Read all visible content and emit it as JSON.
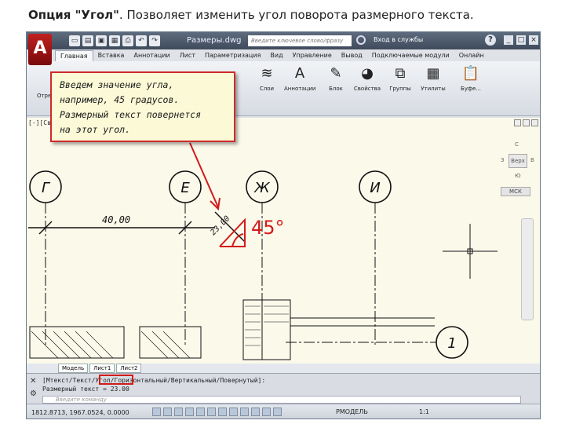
{
  "heading": {
    "bold": "Опция \"Угол\"",
    "text": ". Позволяет изменить угол поворота размерного текста."
  },
  "app": {
    "document_title": "Размеры.dwg",
    "search_placeholder": "Введите ключевое слово/фразу",
    "login_label": "Вход в службы",
    "help_label": "?",
    "window_buttons": [
      "_",
      "□",
      "×"
    ],
    "logo_letter": "A",
    "quick_access_icons": [
      "new-icon",
      "open-icon",
      "save-icon",
      "save-as-icon",
      "print-icon",
      "undo-icon",
      "redo-icon"
    ],
    "quick_access_glyphs": [
      "▭",
      "▤",
      "▣",
      "▦",
      "⎙",
      "↶",
      "↷"
    ]
  },
  "ribbon": {
    "tabs": [
      "Главная",
      "Вставка",
      "Аннотации",
      "Лист",
      "Параметризация",
      "Вид",
      "Управление",
      "Вывод",
      "Подключаемые модули",
      "Онлайн"
    ],
    "active_tab": 0,
    "tools": [
      {
        "label": "Отрез",
        "icon": "line-icon",
        "glyph": "╱"
      },
      {
        "label": "Слои",
        "icon": "layers-icon",
        "glyph": "≋"
      },
      {
        "label": "Аннотации",
        "icon": "text-icon",
        "glyph": "A"
      },
      {
        "label": "Блок",
        "icon": "block-icon",
        "glyph": "✎"
      },
      {
        "label": "Свойства",
        "icon": "properties-icon",
        "glyph": "◕"
      },
      {
        "label": "Группы",
        "icon": "groups-icon",
        "glyph": "⧉"
      },
      {
        "label": "Утилиты",
        "icon": "utilities-icon",
        "glyph": "▦"
      },
      {
        "label": "Буфе...",
        "icon": "clipboard-icon",
        "glyph": "📋"
      }
    ]
  },
  "callout": {
    "lines": [
      "Введем значение угла,",
      "например, 45 градусов.",
      "Размерный текст повернется",
      "на этот угол."
    ]
  },
  "viewport": {
    "label": "[-][Сверху][2D-каркас]",
    "axis_labels": [
      "Г",
      "Е",
      "Ж",
      "И",
      "1"
    ],
    "dimension_text": "40,00",
    "rotated_dimension": "23,00",
    "annotation_angle": "45°",
    "viewcube": {
      "top": "С",
      "west": "З",
      "east": "В",
      "south": "Ю",
      "face": "Верх",
      "wcs": "МСК"
    }
  },
  "layout_tabs": [
    "Модель",
    "Лист1",
    "Лист2"
  ],
  "command": {
    "line1": "[Мтекст/Текст/Угол/Горизонтальный/Вертикальный/Повернутый]:",
    "line2": "Размерный текст = 23.00",
    "input_placeholder": "Введите команду"
  },
  "status": {
    "coordinates": "1812.8713, 1967.0524, 0.0000",
    "model": "РМОДЕЛЬ",
    "scale": "1:1"
  },
  "colors": {
    "annotation_red": "#d21b1b",
    "viewport_bg": "#fbf9ea",
    "callout_bg": "#fbf9d6"
  }
}
